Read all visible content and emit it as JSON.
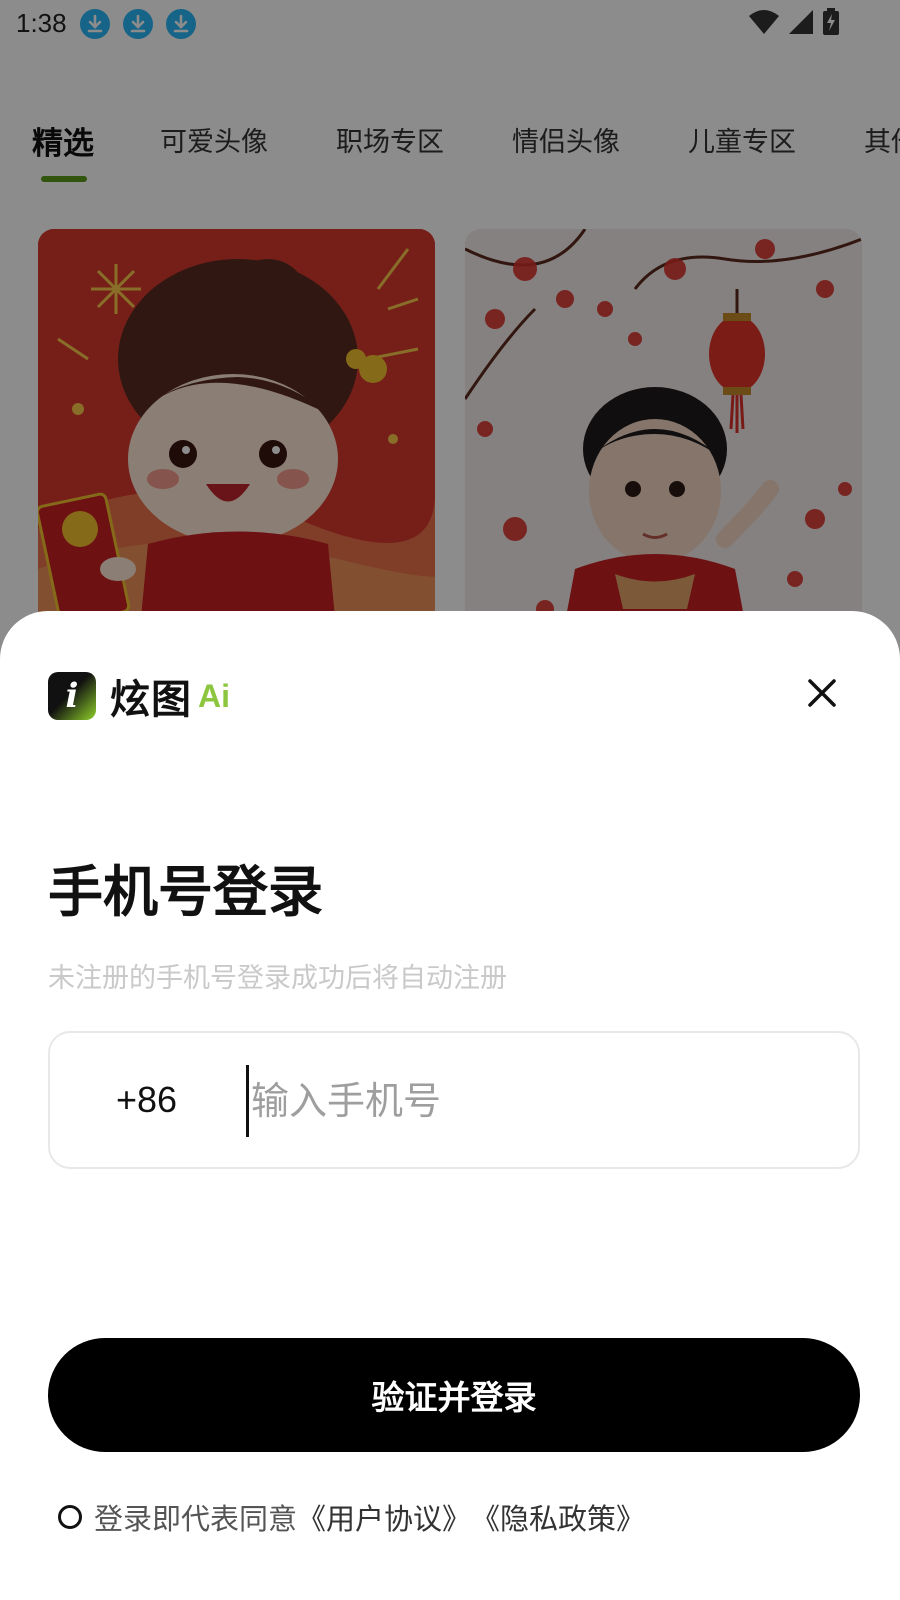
{
  "status_bar": {
    "time": "1:38",
    "download_icons": [
      "download-icon",
      "download-icon",
      "download-icon"
    ],
    "right_icons": [
      "wifi-icon",
      "signal-icon",
      "battery-charging-icon"
    ]
  },
  "tabs": [
    {
      "label": "精选",
      "active": true
    },
    {
      "label": "可爱头像",
      "active": false
    },
    {
      "label": "职场专区",
      "active": false
    },
    {
      "label": "情侣头像",
      "active": false
    },
    {
      "label": "儿童专区",
      "active": false
    },
    {
      "label": "其他",
      "active": false
    }
  ],
  "colors": {
    "accent_green": "#5a9a1a",
    "logo_ai_green": "#8cc63f",
    "button_bg": "#000000",
    "overlay": "rgba(0,0,0,0.45)"
  },
  "sheet": {
    "logo": {
      "icon_letter": "i",
      "name": "炫图",
      "suffix": "Ai"
    },
    "title": "手机号登录",
    "subtitle": "未注册的手机号登录成功后将自动注册",
    "phone": {
      "country_code": "+86",
      "placeholder": "输入手机号",
      "value": ""
    },
    "login_button": "验证并登录",
    "agreement": {
      "checked": false,
      "prefix": "登录即代表同意",
      "user_agreement": "《用户协议》",
      "privacy_policy": "《隐私政策》"
    }
  }
}
